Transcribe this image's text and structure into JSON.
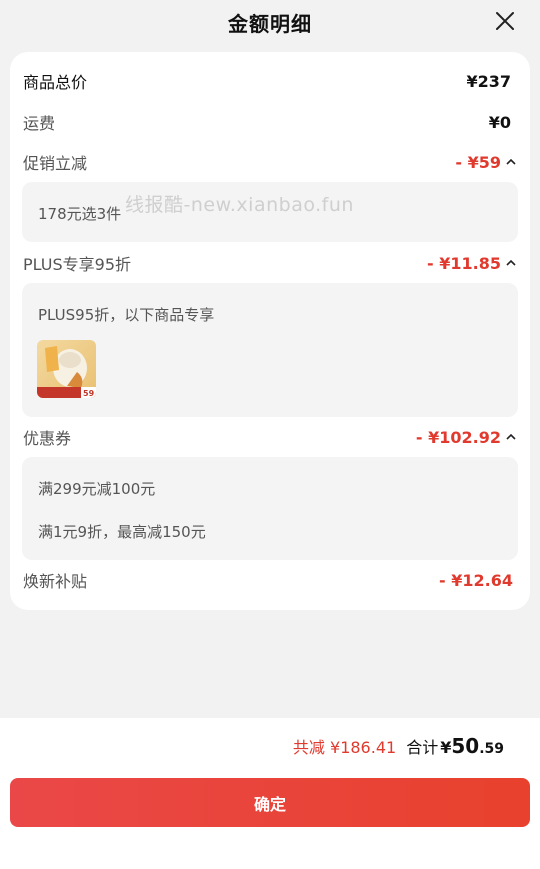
{
  "header": {
    "title": "金额明细"
  },
  "rows": {
    "total": {
      "label": "商品总价",
      "amount": "¥237"
    },
    "shipping": {
      "label": "运费",
      "amount": "¥0"
    },
    "promo": {
      "label": "促销立减",
      "amount": "- ¥59"
    },
    "plus": {
      "label": "PLUS专享95折",
      "amount": "- ¥11.85"
    },
    "coupon": {
      "label": "优惠券",
      "amount": "- ¥102.92"
    },
    "subsidy": {
      "label": "焕新补贴",
      "amount": "- ¥12.64"
    }
  },
  "panels": {
    "promo": {
      "line1": "178元选3件"
    },
    "plus": {
      "line1": "PLUS95折，以下商品专享"
    },
    "coupon": {
      "line1": "满299元减100元",
      "line2": "满1元9折，最高减150元"
    }
  },
  "thumbnail": {
    "price_tag": "59"
  },
  "watermark": "线报酷-new.xianbao.fun",
  "summary": {
    "saved": "共减 ¥186.41",
    "total_label": "合计",
    "currency": "¥",
    "total_int": "50",
    "total_dec": ".59"
  },
  "confirm_button": "确定",
  "colors": {
    "accent_red": "#e03a2e",
    "button_start": "#ea4848",
    "button_end": "#e8412d"
  }
}
